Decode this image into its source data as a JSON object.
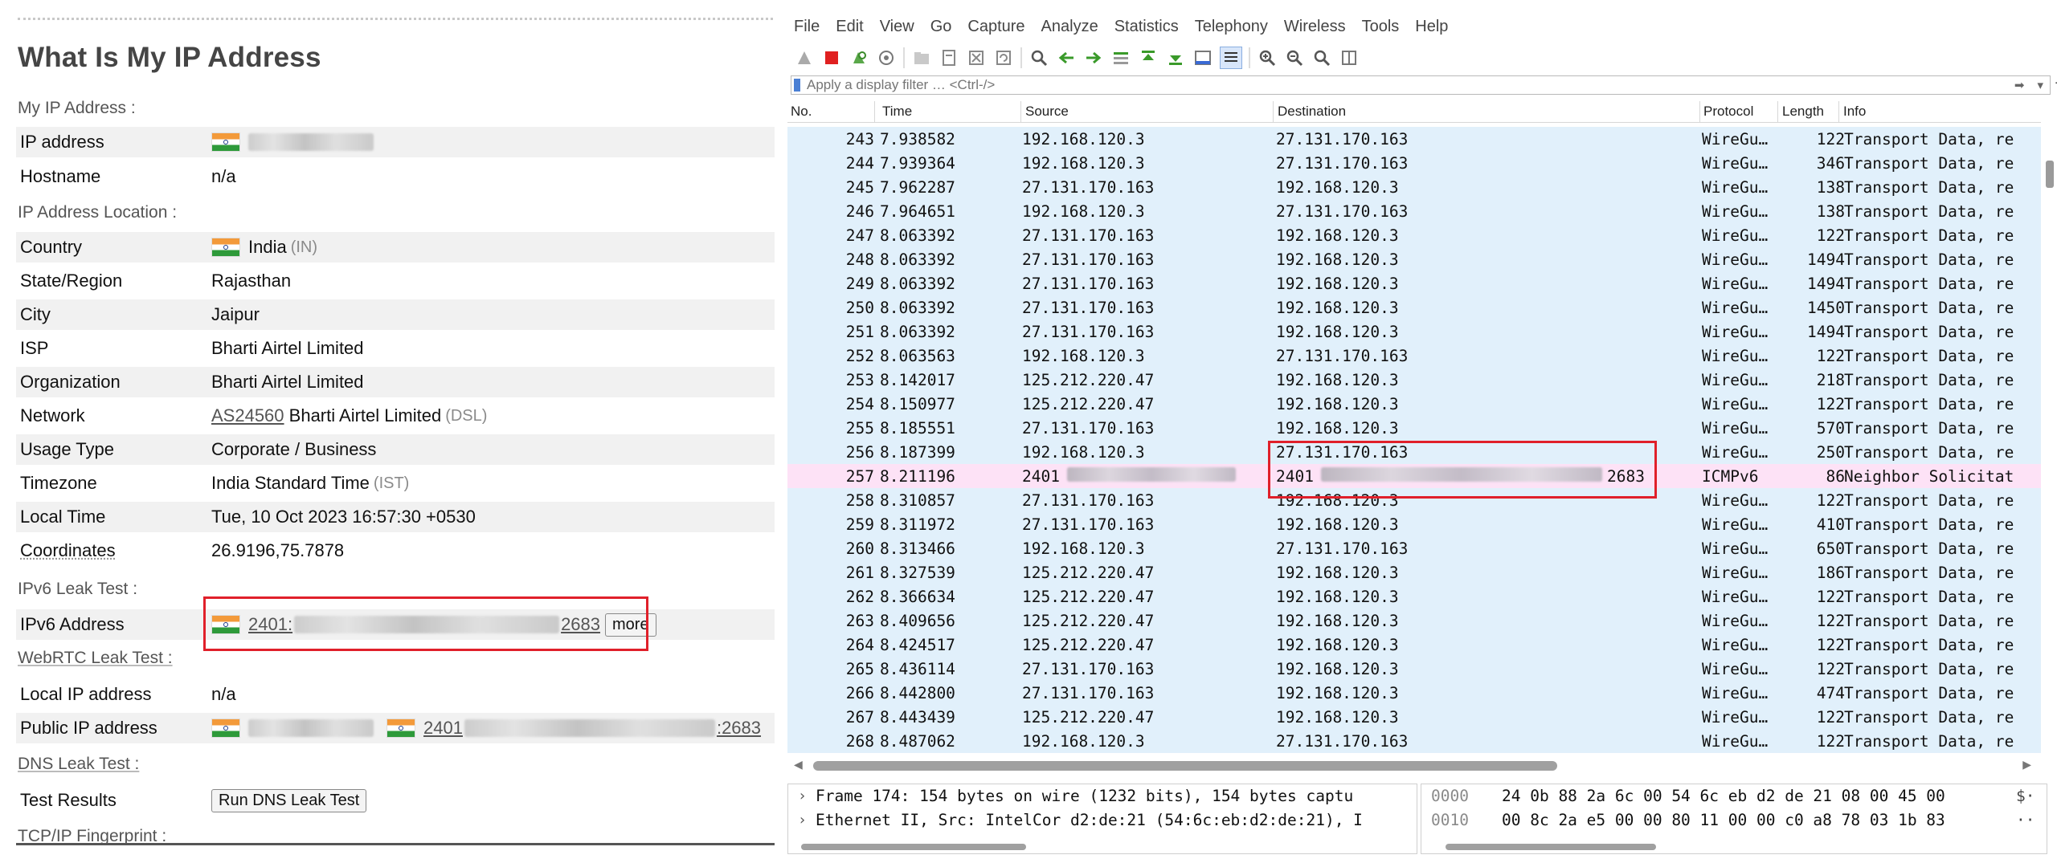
{
  "left": {
    "title": "What Is My IP Address",
    "sections": {
      "my_ip": "My IP Address :",
      "location": "IP Address Location :",
      "ipv6": "IPv6 Leak Test :",
      "webrtc": "WebRTC Leak Test :",
      "dns": "DNS Leak Test :",
      "tcpip": "TCP/IP Fingerprint :"
    },
    "my_ip_rows": [
      {
        "key": "IP address",
        "value": ""
      },
      {
        "key": "Hostname",
        "value": "n/a"
      }
    ],
    "location_rows": [
      {
        "key": "Country",
        "value": "India",
        "paren": "(IN)"
      },
      {
        "key": "State/Region",
        "value": "Rajasthan"
      },
      {
        "key": "City",
        "value": "Jaipur"
      },
      {
        "key": "ISP",
        "value": "Bharti Airtel Limited"
      },
      {
        "key": "Organization",
        "value": "Bharti Airtel Limited"
      },
      {
        "key": "Network",
        "link": "AS24560",
        "value": "Bharti Airtel Limited",
        "paren": "(DSL)"
      },
      {
        "key": "Usage Type",
        "value": "Corporate / Business"
      },
      {
        "key": "Timezone",
        "value": "India Standard Time",
        "paren": "(IST)"
      },
      {
        "key": "Local Time",
        "value": "Tue, 10 Oct 2023 16:57:30 +0530"
      },
      {
        "key": "Coordinates",
        "value": "26.9196,75.7878"
      }
    ],
    "ipv6_row": {
      "key": "IPv6 Address",
      "prefix": "2401:",
      "suffix": "2683",
      "more": "more"
    },
    "webrtc_rows": [
      {
        "key": "Local IP address",
        "value": "n/a"
      },
      {
        "key": "Public IP address",
        "prefix": "2401",
        "suffix": ":2683"
      }
    ],
    "dns_row": {
      "key": "Test Results",
      "button": "Run DNS Leak Test"
    },
    "highlight_color": "#e0202a"
  },
  "wireshark": {
    "menu": [
      "File",
      "Edit",
      "View",
      "Go",
      "Capture",
      "Analyze",
      "Statistics",
      "Telephony",
      "Wireless",
      "Tools",
      "Help"
    ],
    "filter_placeholder": "Apply a display filter … <Ctrl-/>",
    "columns": [
      "No.",
      "Time",
      "Source",
      "Destination",
      "Protocol",
      "Length",
      "Info"
    ],
    "rows": [
      {
        "no": "243",
        "time": "7.938582",
        "src": "192.168.120.3",
        "dst": "27.131.170.163",
        "proto": "WireGu…",
        "len": "122",
        "info": "Transport Data, re"
      },
      {
        "no": "244",
        "time": "7.939364",
        "src": "192.168.120.3",
        "dst": "27.131.170.163",
        "proto": "WireGu…",
        "len": "346",
        "info": "Transport Data, re"
      },
      {
        "no": "245",
        "time": "7.962287",
        "src": "27.131.170.163",
        "dst": "192.168.120.3",
        "proto": "WireGu…",
        "len": "138",
        "info": "Transport Data, re"
      },
      {
        "no": "246",
        "time": "7.964651",
        "src": "192.168.120.3",
        "dst": "27.131.170.163",
        "proto": "WireGu…",
        "len": "138",
        "info": "Transport Data, re"
      },
      {
        "no": "247",
        "time": "8.063392",
        "src": "27.131.170.163",
        "dst": "192.168.120.3",
        "proto": "WireGu…",
        "len": "122",
        "info": "Transport Data, re"
      },
      {
        "no": "248",
        "time": "8.063392",
        "src": "27.131.170.163",
        "dst": "192.168.120.3",
        "proto": "WireGu…",
        "len": "1494",
        "info": "Transport Data, re"
      },
      {
        "no": "249",
        "time": "8.063392",
        "src": "27.131.170.163",
        "dst": "192.168.120.3",
        "proto": "WireGu…",
        "len": "1494",
        "info": "Transport Data, re"
      },
      {
        "no": "250",
        "time": "8.063392",
        "src": "27.131.170.163",
        "dst": "192.168.120.3",
        "proto": "WireGu…",
        "len": "1450",
        "info": "Transport Data, re"
      },
      {
        "no": "251",
        "time": "8.063392",
        "src": "27.131.170.163",
        "dst": "192.168.120.3",
        "proto": "WireGu…",
        "len": "1494",
        "info": "Transport Data, re"
      },
      {
        "no": "252",
        "time": "8.063563",
        "src": "192.168.120.3",
        "dst": "27.131.170.163",
        "proto": "WireGu…",
        "len": "122",
        "info": "Transport Data, re"
      },
      {
        "no": "253",
        "time": "8.142017",
        "src": "125.212.220.47",
        "dst": "192.168.120.3",
        "proto": "WireGu…",
        "len": "218",
        "info": "Transport Data, re"
      },
      {
        "no": "254",
        "time": "8.150977",
        "src": "125.212.220.47",
        "dst": "192.168.120.3",
        "proto": "WireGu…",
        "len": "122",
        "info": "Transport Data, re"
      },
      {
        "no": "255",
        "time": "8.185551",
        "src": "27.131.170.163",
        "dst": "192.168.120.3",
        "proto": "WireGu…",
        "len": "570",
        "info": "Transport Data, re"
      },
      {
        "no": "256",
        "time": "8.187399",
        "src": "192.168.120.3",
        "dst": "27.131.170.163",
        "proto": "WireGu…",
        "len": "250",
        "info": "Transport Data, re"
      },
      {
        "no": "257",
        "time": "8.211196",
        "src": "2401",
        "dst": "2401",
        "dst_suffix": "2683",
        "proto": "ICMPv6",
        "len": "86",
        "info": "Neighbor Solicitat",
        "icmp": true
      },
      {
        "no": "258",
        "time": "8.310857",
        "src": "27.131.170.163",
        "dst": "192.168.120.3",
        "proto": "WireGu…",
        "len": "122",
        "info": "Transport Data, re"
      },
      {
        "no": "259",
        "time": "8.311972",
        "src": "27.131.170.163",
        "dst": "192.168.120.3",
        "proto": "WireGu…",
        "len": "410",
        "info": "Transport Data, re"
      },
      {
        "no": "260",
        "time": "8.313466",
        "src": "192.168.120.3",
        "dst": "27.131.170.163",
        "proto": "WireGu…",
        "len": "650",
        "info": "Transport Data, re"
      },
      {
        "no": "261",
        "time": "8.327539",
        "src": "125.212.220.47",
        "dst": "192.168.120.3",
        "proto": "WireGu…",
        "len": "186",
        "info": "Transport Data, re"
      },
      {
        "no": "262",
        "time": "8.366634",
        "src": "125.212.220.47",
        "dst": "192.168.120.3",
        "proto": "WireGu…",
        "len": "122",
        "info": "Transport Data, re"
      },
      {
        "no": "263",
        "time": "8.409656",
        "src": "125.212.220.47",
        "dst": "192.168.120.3",
        "proto": "WireGu…",
        "len": "122",
        "info": "Transport Data, re"
      },
      {
        "no": "264",
        "time": "8.424517",
        "src": "125.212.220.47",
        "dst": "192.168.120.3",
        "proto": "WireGu…",
        "len": "122",
        "info": "Transport Data, re"
      },
      {
        "no": "265",
        "time": "8.436114",
        "src": "27.131.170.163",
        "dst": "192.168.120.3",
        "proto": "WireGu…",
        "len": "122",
        "info": "Transport Data, re"
      },
      {
        "no": "266",
        "time": "8.442800",
        "src": "27.131.170.163",
        "dst": "192.168.120.3",
        "proto": "WireGu…",
        "len": "474",
        "info": "Transport Data, re"
      },
      {
        "no": "267",
        "time": "8.443439",
        "src": "125.212.220.47",
        "dst": "192.168.120.3",
        "proto": "WireGu…",
        "len": "122",
        "info": "Transport Data, re"
      },
      {
        "no": "268",
        "time": "8.487062",
        "src": "192.168.120.3",
        "dst": "27.131.170.163",
        "proto": "WireGu…",
        "len": "122",
        "info": "Transport Data, re"
      }
    ],
    "details": [
      "Frame 174: 154 bytes on wire (1232 bits), 154 bytes captu",
      "Ethernet II, Src: IntelCor d2:de:21 (54:6c:eb:d2:de:21), I"
    ],
    "hex": [
      {
        "offset": "0000",
        "bytes": "24 0b 88 2a 6c 00 54 6c  eb d2 de 21 08 00 45 00",
        "ascii": "$·"
      },
      {
        "offset": "0010",
        "bytes": "00 8c 2a e5 00 00 80 11  00 00 c0 a8 78 03 1b 83",
        "ascii": "··"
      }
    ],
    "colors": {
      "row_udp": "#e1f0fb",
      "row_icmp": "#fde2f6",
      "highlight": "#e0202a"
    }
  }
}
